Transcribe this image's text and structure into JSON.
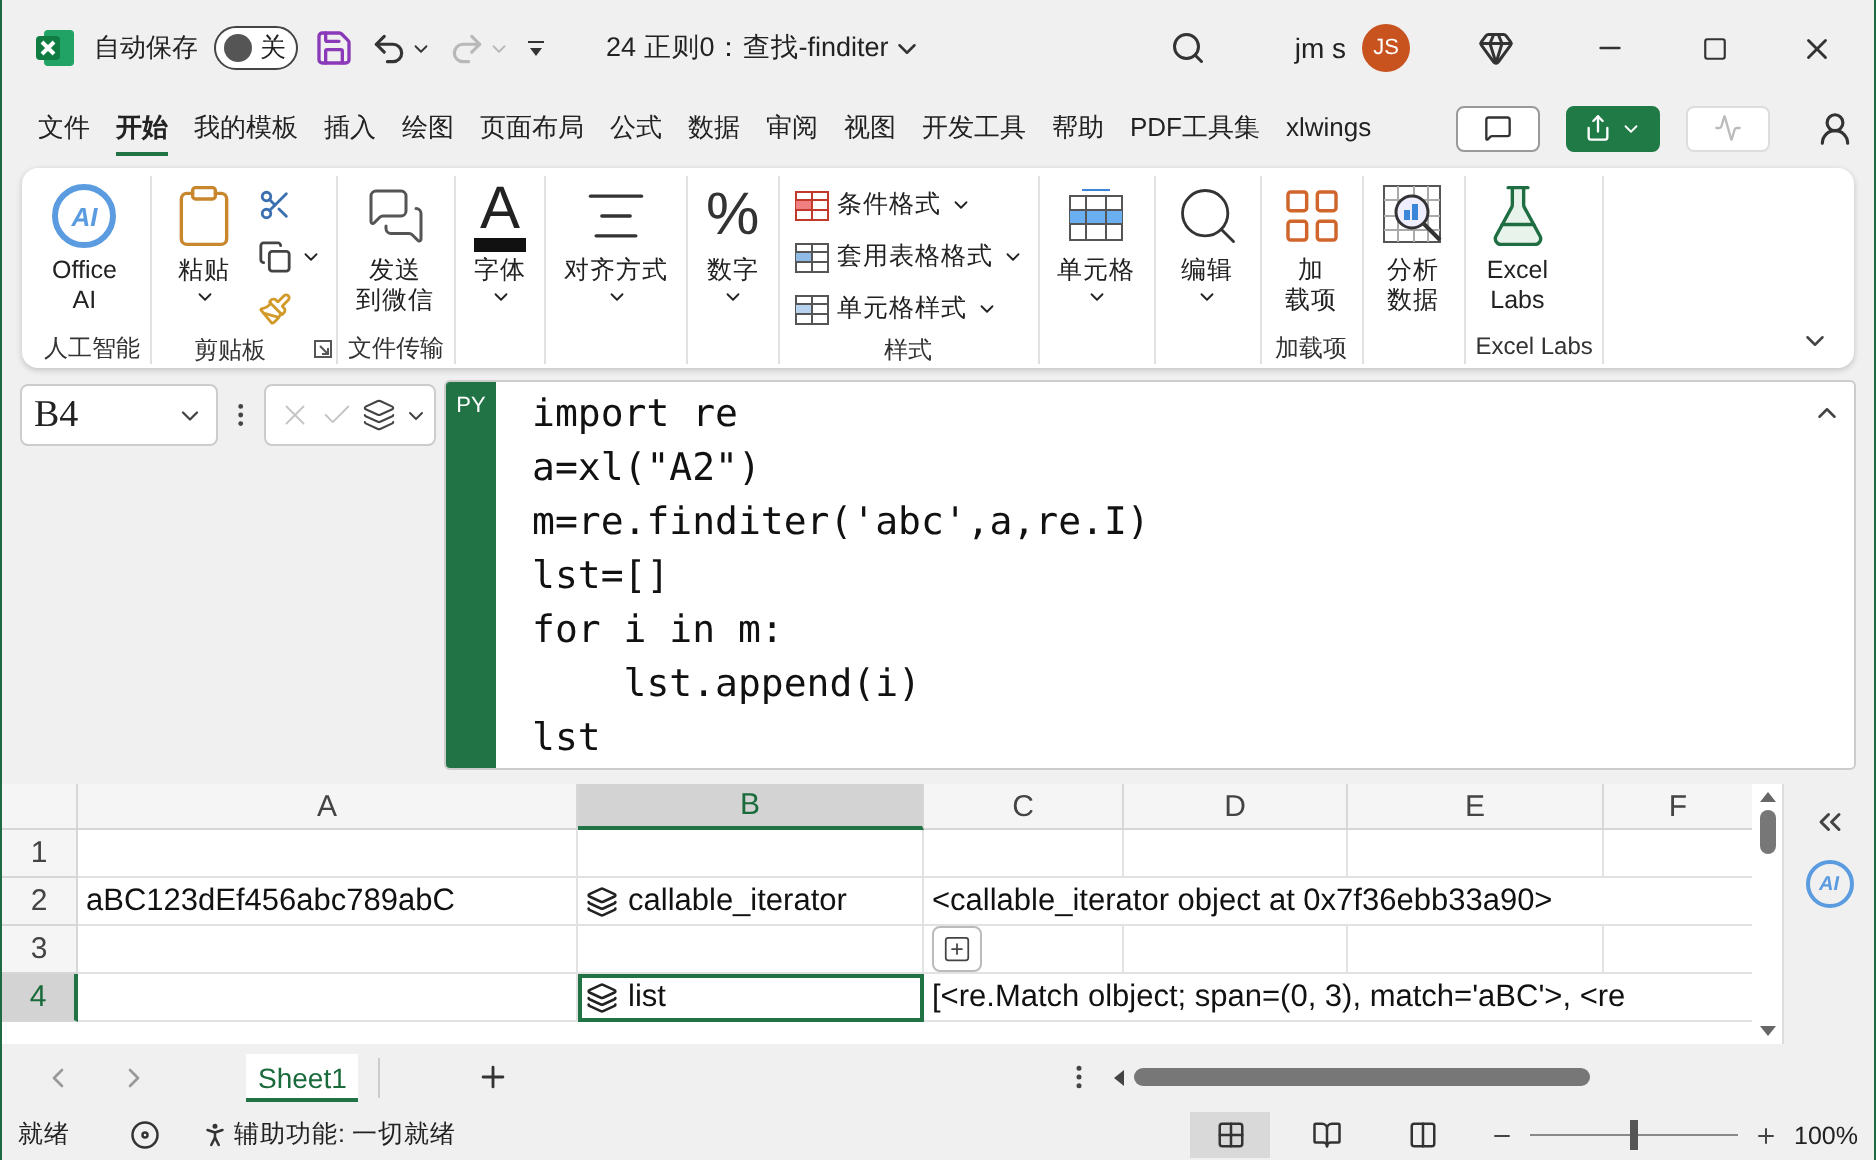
{
  "title_bar": {
    "autosave_label": "自动保存",
    "autosave": {
      "label": "关",
      "on": false
    },
    "document_title": "24 正则0：查找-finditer",
    "user_name": "jm s",
    "avatar_initials": "JS"
  },
  "menu_tabs": [
    {
      "label": "文件",
      "selected": false
    },
    {
      "label": "开始",
      "selected": true
    },
    {
      "label": "我的模板",
      "selected": false
    },
    {
      "label": "插入",
      "selected": false
    },
    {
      "label": "绘图",
      "selected": false
    },
    {
      "label": "页面布局",
      "selected": false
    },
    {
      "label": "公式",
      "selected": false
    },
    {
      "label": "数据",
      "selected": false
    },
    {
      "label": "审阅",
      "selected": false
    },
    {
      "label": "视图",
      "selected": false
    },
    {
      "label": "开发工具",
      "selected": false
    },
    {
      "label": "帮助",
      "selected": false
    },
    {
      "label": "PDF工具集",
      "selected": false
    },
    {
      "label": "xlwings",
      "selected": false
    }
  ],
  "ribbon": {
    "groups": [
      {
        "label": "人工智能",
        "items": [
          {
            "kind": "assistant",
            "badge": "AI",
            "lines": [
              "Office",
              "AI"
            ],
            "dropdown": false
          }
        ]
      },
      {
        "label": "剪贴板",
        "launcher": true,
        "items": [
          {
            "kind": "paste",
            "lines": [
              "粘贴"
            ],
            "dropdown": true
          },
          {
            "kind": "cut",
            "dropdown": false
          },
          {
            "kind": "copy",
            "dropdown": true
          },
          {
            "kind": "painter",
            "dropdown": false
          }
        ]
      },
      {
        "label": "文件传输",
        "items": [
          {
            "kind": "wechat",
            "lines": [
              "发送",
              "到微信"
            ],
            "dropdown": false
          }
        ]
      },
      {
        "items": [
          {
            "kind": "font",
            "glyph": "A",
            "lines": [
              "字体"
            ],
            "dropdown": true
          }
        ]
      },
      {
        "items": [
          {
            "kind": "align",
            "lines": [
              "对齐方式"
            ],
            "dropdown": true
          }
        ]
      },
      {
        "items": [
          {
            "kind": "number",
            "glyph": "%",
            "lines": [
              "数字"
            ],
            "dropdown": true
          }
        ]
      },
      {
        "label": "样式",
        "items": [
          {
            "kind": "conditional",
            "lines": [
              "条件格式"
            ],
            "dropdown": true
          },
          {
            "kind": "tablestyle",
            "lines": [
              "套用表格格式"
            ],
            "dropdown": true
          },
          {
            "kind": "cellstyle",
            "lines": [
              "单元格样式"
            ],
            "dropdown": true
          }
        ]
      },
      {
        "items": [
          {
            "kind": "cells",
            "lines": [
              "单元格"
            ],
            "dropdown": true
          }
        ]
      },
      {
        "items": [
          {
            "kind": "find",
            "lines": [
              "编辑"
            ],
            "dropdown": true
          }
        ]
      },
      {
        "label": "加载项",
        "items": [
          {
            "kind": "addins",
            "lines": [
              "加",
              "载项"
            ],
            "dropdown": false
          }
        ]
      },
      {
        "items": [
          {
            "kind": "analyze",
            "lines": [
              "分析",
              "数据"
            ],
            "dropdown": false
          }
        ]
      },
      {
        "label": "Excel Labs",
        "items": [
          {
            "kind": "labs",
            "lines": [
              "Excel",
              "Labs"
            ],
            "dropdown": false
          }
        ]
      }
    ]
  },
  "formula_bar": {
    "name_box": "B4",
    "language_badge": "PY",
    "code_lines": [
      "import re",
      "a=xl(\"A2\")",
      "m=re.finditer('abc',a,re.I)",
      "lst=[]",
      "for i in m:",
      "    lst.append(i)",
      "lst"
    ]
  },
  "sheet": {
    "columns": [
      {
        "label": "A",
        "selected": false
      },
      {
        "label": "B",
        "selected": true
      },
      {
        "label": "C",
        "selected": false
      },
      {
        "label": "D",
        "selected": false
      },
      {
        "label": "E",
        "selected": false
      },
      {
        "label": "F",
        "selected": false
      }
    ],
    "rows": [
      {
        "header": "1",
        "selected": false
      },
      {
        "header": "2",
        "selected": false,
        "cells": [
          {
            "kind": "text",
            "text": "aBC123dEf456abc789abC",
            "selected": false
          },
          {
            "kind": "python",
            "text": "callable_iterator",
            "selected": false
          },
          {
            "kind": "text",
            "text": "<callable_iterator object at 0x7f36ebb33a90>",
            "selected": false
          }
        ]
      },
      {
        "header": "3",
        "selected": false
      },
      {
        "header": "4",
        "selected": true,
        "cells": [
          {
            "kind": "empty",
            "selected": false
          },
          {
            "kind": "python",
            "text": "list",
            "selected": true
          },
          {
            "kind": "text",
            "text": "[<re.Match olbject; span=(0, 3), match='aBC'>, <re",
            "selected": false
          }
        ]
      }
    ]
  },
  "assistant_badge": "AI",
  "sheet_tabs": [
    {
      "label": "Sheet1",
      "selected": true
    }
  ],
  "status_bar": {
    "ready": "就绪",
    "accessibility": "辅助功能: 一切就绪",
    "views": [
      {
        "kind": "normal",
        "selected": true
      },
      {
        "kind": "layout",
        "selected": false
      },
      {
        "kind": "pagebreak",
        "selected": false
      }
    ],
    "zoom": {
      "level": 0.5,
      "reading": "100%"
    }
  }
}
